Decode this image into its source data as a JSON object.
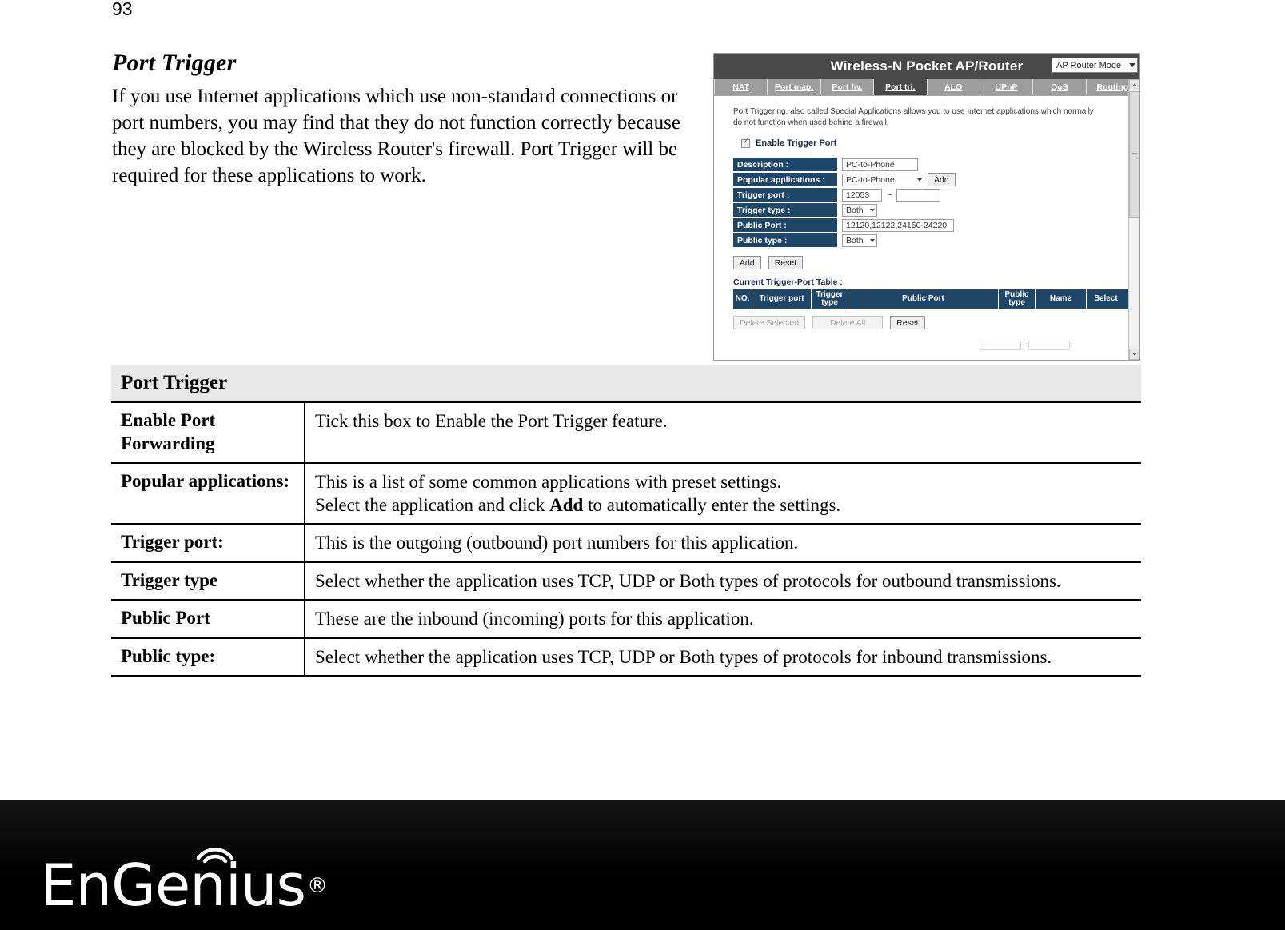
{
  "page": {
    "number": "93"
  },
  "document": {
    "title": "Port Trigger",
    "paragraph": "If you use Internet applications which use non-standard connections or port numbers, you may find that they do not function correctly because they are blocked by the Wireless Router's firewall. Port Trigger will be required for these applications to work."
  },
  "router_ui": {
    "header": {
      "title": "Wireless-N Pocket AP/Router",
      "mode_selected": "AP Router Mode"
    },
    "tabs": [
      {
        "label": "NAT",
        "active": false
      },
      {
        "label": "Port map.",
        "active": false
      },
      {
        "label": "Port fw.",
        "active": false
      },
      {
        "label": "Port tri.",
        "active": true
      },
      {
        "label": "ALG",
        "active": false
      },
      {
        "label": "UPnP",
        "active": false
      },
      {
        "label": "QoS",
        "active": false
      },
      {
        "label": "Routing",
        "active": false
      }
    ],
    "intro": "Port Triggering, also called Special Applications allows you to use Internet applications which normally do not function when used behind a firewall.",
    "enable_label": "Enable Trigger Port",
    "enable_checked": true,
    "form": {
      "description_label": "Description :",
      "description_value": "PC-to-Phone",
      "popular_label": "Popular applications :",
      "popular_value": "PC-to-Phone",
      "popular_add_button": "Add",
      "trigger_port_label": "Trigger port :",
      "trigger_port_from": "12053",
      "trigger_port_to": "",
      "trigger_port_separator": "~",
      "trigger_type_label": "Trigger type :",
      "trigger_type_value": "Both",
      "public_port_label": "Public Port :",
      "public_port_value": "12120,12122,24150-24220",
      "public_type_label": "Public type :",
      "public_type_value": "Both"
    },
    "actions": {
      "add": "Add",
      "reset": "Reset"
    },
    "table": {
      "title": "Current Trigger-Port Table :",
      "columns": [
        "NO.",
        "Trigger port",
        "Trigger type",
        "Public Port",
        "Public type",
        "Name",
        "Select"
      ],
      "rows": []
    },
    "table_actions": {
      "delete_selected": "Delete Selected",
      "delete_all": "Delete All",
      "reset": "Reset"
    },
    "colors": {
      "header_bar": "#4a4a4a",
      "tab_bar": "#9d9d9d",
      "field_label": "#1d4669",
      "text_dark": "#1b2b45"
    }
  },
  "description_table": {
    "caption": "Port Trigger",
    "rows": [
      {
        "key": "Enable Port Forwarding",
        "lines": [
          "Tick this box to Enable the Port Trigger feature."
        ]
      },
      {
        "key": "Popular applications:",
        "lines": [
          "This is a list of some common applications with preset settings.",
          "Select the application and click Add to automatically enter the settings."
        ],
        "bold_word": "Add"
      },
      {
        "key": "Trigger port:",
        "lines": [
          "This is the outgoing (outbound) port numbers for this application."
        ]
      },
      {
        "key": "Trigger type",
        "lines": [
          "Select whether the application uses TCP, UDP or Both types of protocols for outbound transmissions."
        ]
      },
      {
        "key": "Public Port",
        "lines": [
          "These are the inbound (incoming) ports for this application."
        ]
      },
      {
        "key": "Public type:",
        "lines": [
          "Select whether the application uses TCP, UDP or Both types of protocols for inbound transmissions."
        ]
      }
    ]
  },
  "footer": {
    "brand": "EnGenius",
    "registered_mark": "®"
  }
}
